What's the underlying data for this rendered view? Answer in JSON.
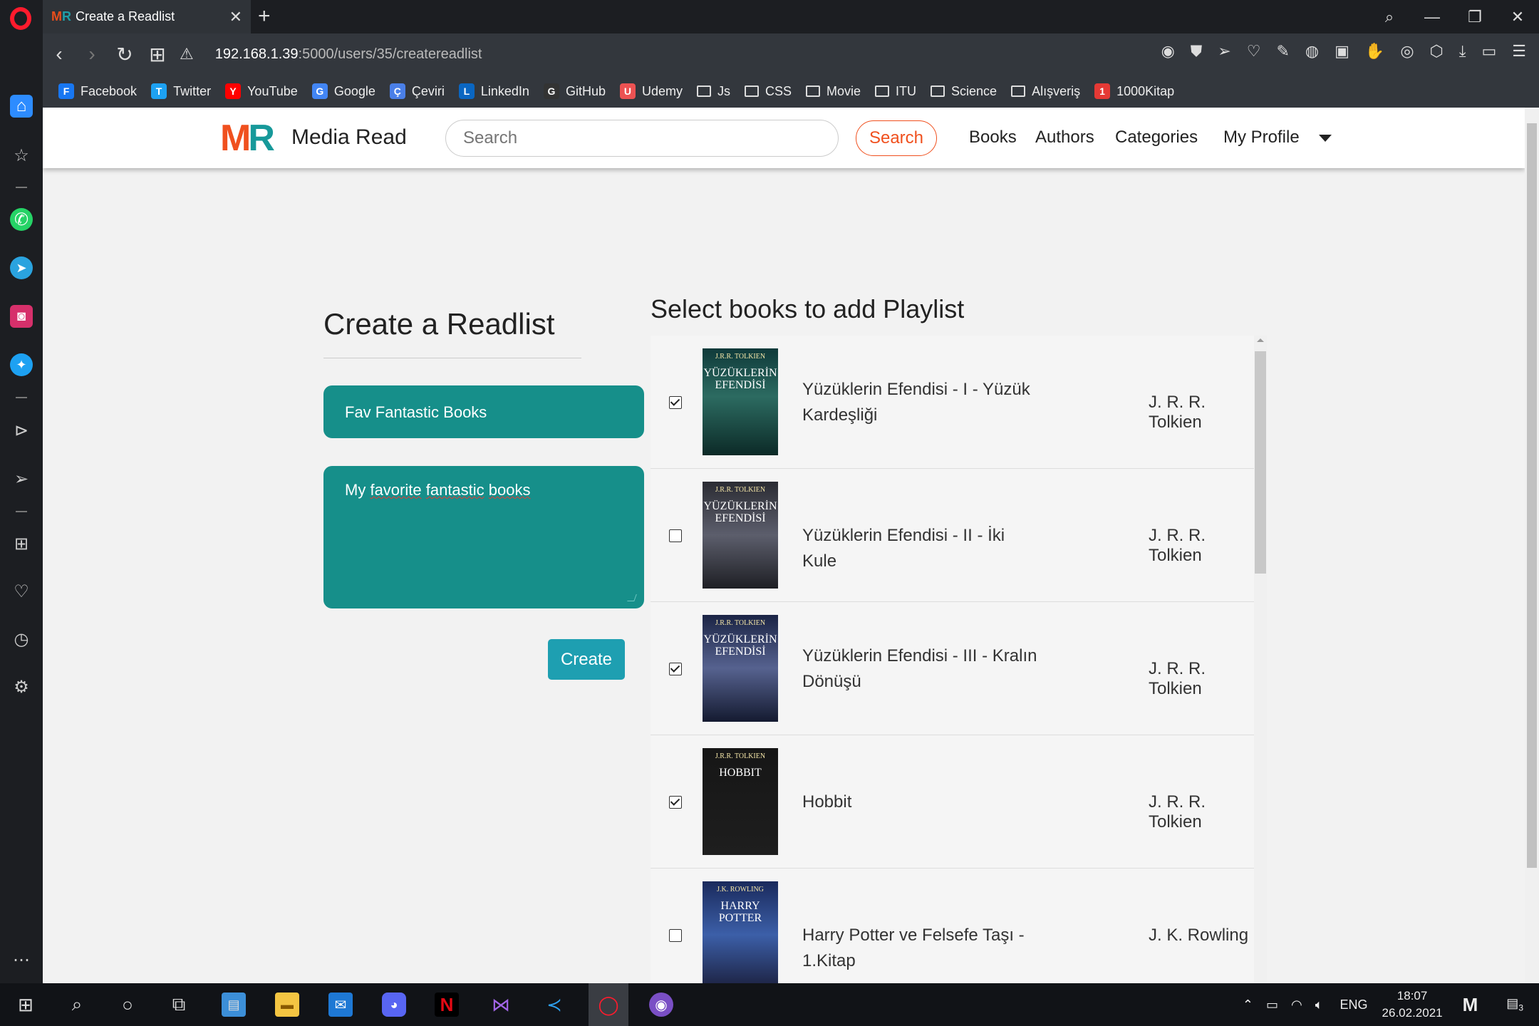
{
  "browser": {
    "tab_title": "Create a Readlist",
    "tab_favicon": "MR",
    "url_host": "192.168.1.39",
    "url_path": ":5000/users/35/createreadlist",
    "bookmarks": [
      {
        "label": "Facebook",
        "icon": "facebook-icon",
        "color": "#1877f2"
      },
      {
        "label": "Twitter",
        "icon": "twitter-icon",
        "color": "#1da1f2"
      },
      {
        "label": "YouTube",
        "icon": "youtube-icon",
        "color": "#ff0000"
      },
      {
        "label": "Google",
        "icon": "google-icon",
        "color": "#4285f4"
      },
      {
        "label": "Çeviri",
        "icon": "translate-icon",
        "color": "#4a7fe8"
      },
      {
        "label": "LinkedIn",
        "icon": "linkedin-icon",
        "color": "#0a66c2"
      },
      {
        "label": "GitHub",
        "icon": "github-icon",
        "color": "#333333"
      },
      {
        "label": "Udemy",
        "icon": "udemy-icon",
        "color": "#ec5252"
      },
      {
        "label": "Js",
        "icon": "folder-icon",
        "color": "none"
      },
      {
        "label": "CSS",
        "icon": "folder-icon",
        "color": "none"
      },
      {
        "label": "Movie",
        "icon": "folder-icon",
        "color": "none"
      },
      {
        "label": "ITU",
        "icon": "folder-icon",
        "color": "none"
      },
      {
        "label": "Science",
        "icon": "folder-icon",
        "color": "none"
      },
      {
        "label": "Alışveriş",
        "icon": "folder-icon",
        "color": "none"
      },
      {
        "label": "1000Kitap",
        "icon": "1000kitap-icon",
        "color": "#e53935"
      }
    ]
  },
  "navbar": {
    "logo": {
      "m": "M",
      "r": "R"
    },
    "brand": "Media Read",
    "search_placeholder": "Search",
    "search_button": "Search",
    "links": [
      "Books",
      "Authors",
      "Categories",
      "My Profile"
    ],
    "accent_color": "#f0501e",
    "brand_teal": "#17999a"
  },
  "form": {
    "title": "Create a Readlist",
    "name_value": "Fav Fantastic Books",
    "description_words": [
      "My ",
      "favorite",
      " ",
      "fantastic",
      " ",
      "books"
    ],
    "create_button": "Create",
    "field_color": "#168f8a"
  },
  "book_list": {
    "heading": "Select books to add Playlist",
    "books": [
      {
        "title": "Yüzüklerin Efendisi - I - Yüzük Kardeşliği",
        "author": "J. R. R. Tolkien",
        "checked": true,
        "cover_title": "YÜZÜKLERİN EFENDİSİ",
        "cover_author": "J.R.R. TOLKIEN"
      },
      {
        "title": "Yüzüklerin Efendisi - II - İki Kule",
        "author": "J. R. R. Tolkien",
        "checked": false,
        "cover_title": "YÜZÜKLERİN EFENDİSİ",
        "cover_author": "J.R.R. TOLKIEN"
      },
      {
        "title": "Yüzüklerin Efendisi - III - Kralın Dönüşü",
        "author": "J. R. R. Tolkien",
        "checked": true,
        "cover_title": "YÜZÜKLERİN EFENDİSİ",
        "cover_author": "J.R.R. TOLKIEN"
      },
      {
        "title": "Hobbit",
        "author": "J. R. R. Tolkien",
        "checked": true,
        "cover_title": "HOBBIT",
        "cover_author": "J.R.R. TOLKIEN"
      },
      {
        "title": "Harry Potter ve Felsefe Taşı - 1.Kitap",
        "author": "J. K. Rowling",
        "checked": false,
        "cover_title": "HARRY POTTER",
        "cover_author": "J.K. ROWLING"
      }
    ]
  },
  "taskbar": {
    "language": "ENG",
    "time": "18:07",
    "date": "26.02.2021",
    "notification_count": "3"
  }
}
